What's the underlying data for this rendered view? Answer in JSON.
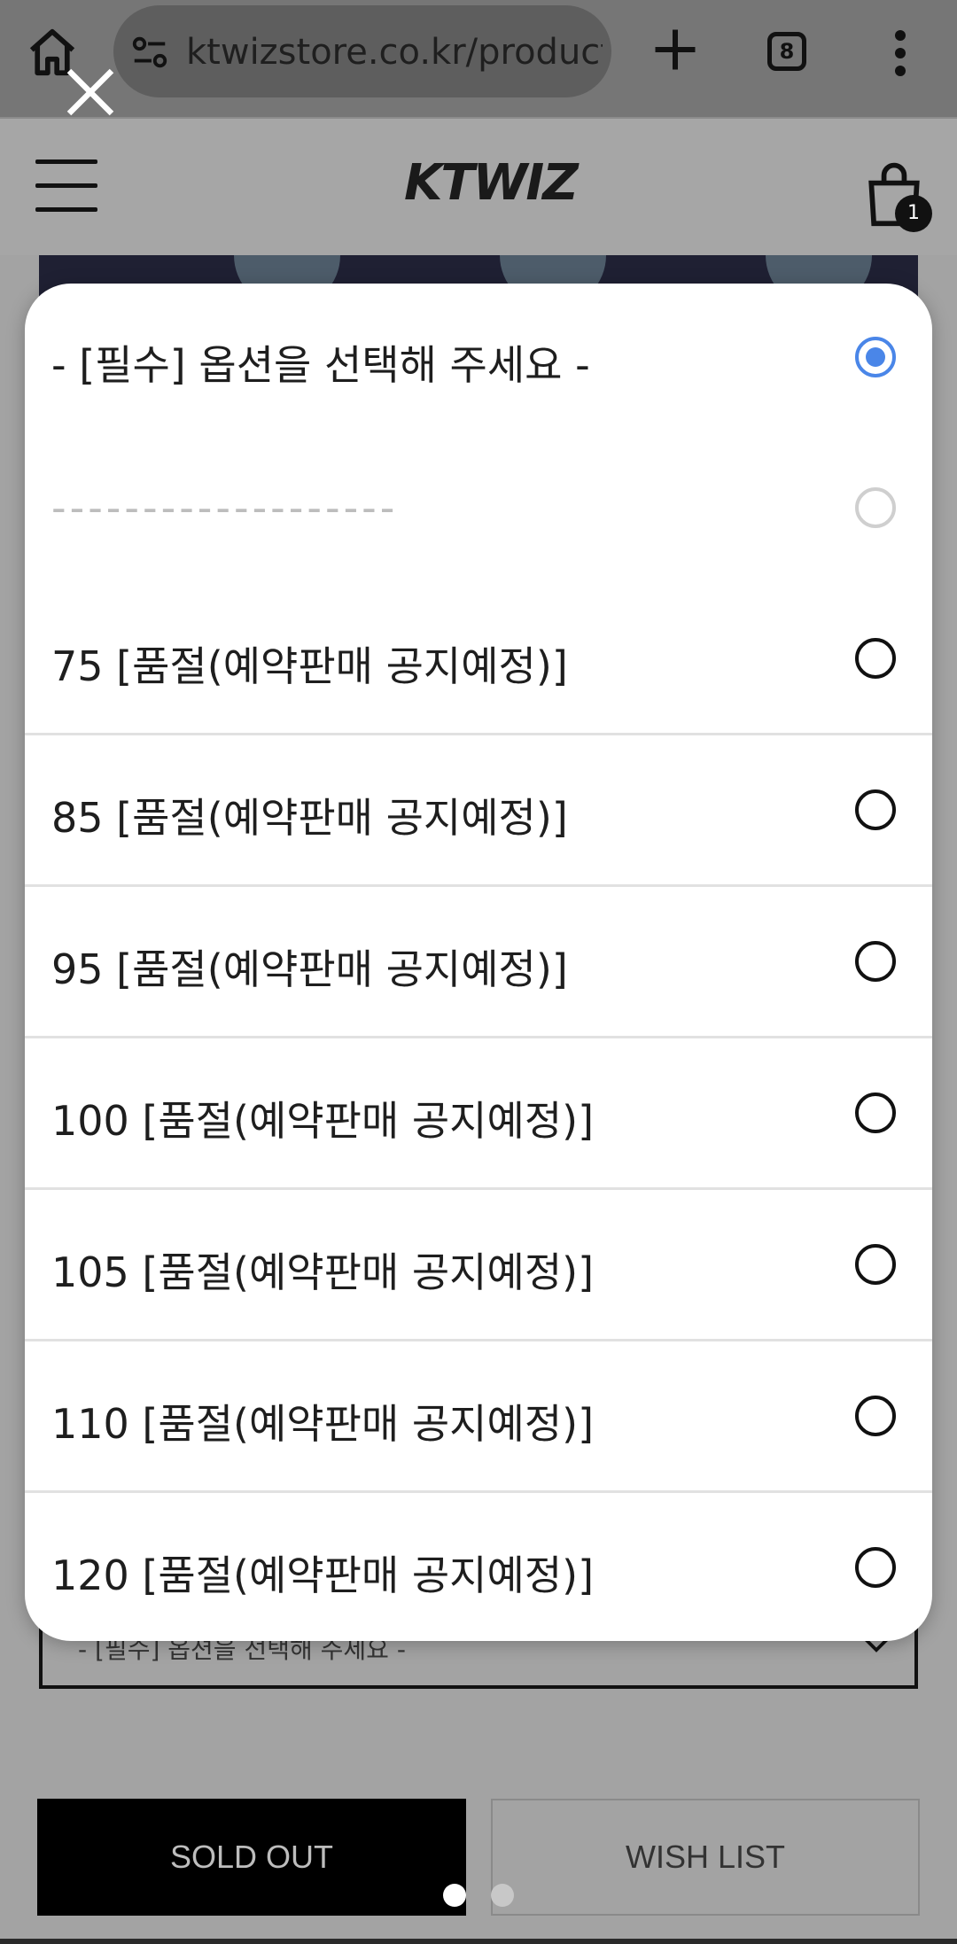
{
  "browser": {
    "url": "ktwizstore.co.kr/product.",
    "tab_count": "8"
  },
  "site": {
    "logo": "KTWIZ",
    "cart_count": "1"
  },
  "sheet": {
    "options": [
      {
        "label": "- [필수] 옵션을 선택해 주세요 -",
        "state": "selected"
      },
      {
        "label": "-------------------",
        "state": "disabled"
      },
      {
        "label": "75 [품절(예약판매 공지예정)]",
        "state": "unselected"
      },
      {
        "label": "85 [품절(예약판매 공지예정)]",
        "state": "unselected"
      },
      {
        "label": "95 [품절(예약판매 공지예정)]",
        "state": "unselected"
      },
      {
        "label": "100 [품절(예약판매 공지예정)]",
        "state": "unselected"
      },
      {
        "label": "105 [품절(예약판매 공지예정)]",
        "state": "unselected"
      },
      {
        "label": "110 [품절(예약판매 공지예정)]",
        "state": "unselected"
      },
      {
        "label": "120 [품절(예약판매 공지예정)]",
        "state": "unselected"
      }
    ]
  },
  "page": {
    "select_label": "- [필수] 옵션을 선택해 주세요 -",
    "sold_out_label": "SOLD OUT",
    "wish_list_label": "WISH LIST"
  },
  "colors": {
    "selected_radio": "#4a86e8",
    "sold_out_bg": "#000000"
  },
  "icons": [
    "home-icon",
    "site-info-icon",
    "plus-icon",
    "tab-switcher-icon",
    "more-vert-icon",
    "close-icon",
    "menu-icon",
    "cart-icon",
    "chevron-down-icon"
  ]
}
